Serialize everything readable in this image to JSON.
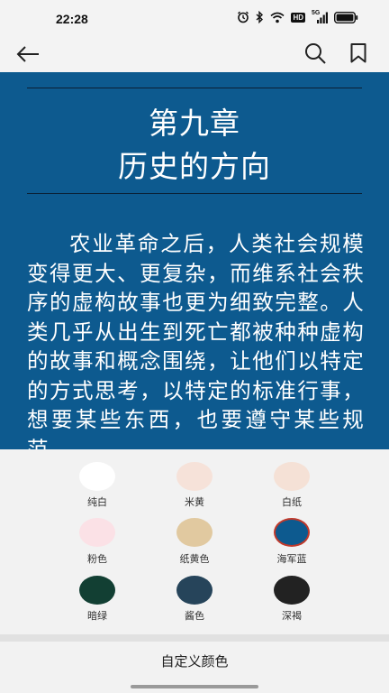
{
  "status_bar": {
    "time": "22:28",
    "hd_label": "HD",
    "network_label": "5G"
  },
  "app_bar": {
    "back_icon": "arrow-left-icon",
    "search_icon": "search-icon",
    "bookmark_icon": "bookmark-icon"
  },
  "reader": {
    "background_color": "#0d5a8f",
    "chapter_number": "第九章",
    "chapter_title": "历史的方向",
    "body": "农业革命之后，人类社会规模变得更大、更复杂，而维系社会秩序的虚构故事也更为细致完整。人类几乎从出生到死亡都被种种虚构的故事和概念围绕，让他们以特定的方式思考，以特定的标准行事，想要某些东西，也要遵守某些规范。"
  },
  "color_panel": {
    "swatches": [
      {
        "label": "纯白",
        "color": "#ffffff",
        "selected": false
      },
      {
        "label": "米黄",
        "color": "#f6e2d9",
        "selected": false
      },
      {
        "label": "白纸",
        "color": "#f5e1d6",
        "selected": false
      },
      {
        "label": "粉色",
        "color": "#fbe1e6",
        "selected": false
      },
      {
        "label": "纸黄色",
        "color": "#e1c9a0",
        "selected": false
      },
      {
        "label": "海军蓝",
        "color": "#0d5a8f",
        "selected": true
      },
      {
        "label": "暗绿",
        "color": "#123f33",
        "selected": false
      },
      {
        "label": "酱色",
        "color": "#26445a",
        "selected": false
      },
      {
        "label": "深褐",
        "color": "#222222",
        "selected": false
      }
    ],
    "custom_label": "自定义颜色"
  }
}
